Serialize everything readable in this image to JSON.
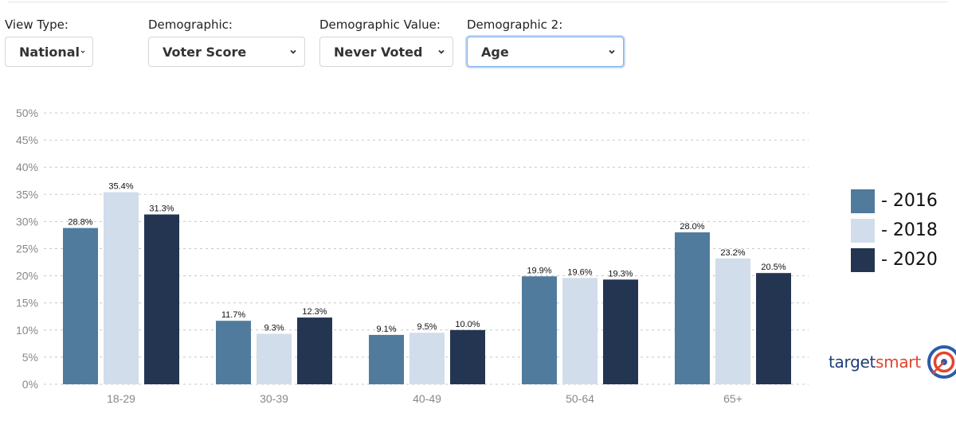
{
  "controls": [
    {
      "label": "View Type:",
      "value": "National"
    },
    {
      "label": "Demographic:",
      "value": "Voter Score"
    },
    {
      "label": "Demographic Value:",
      "value": "Never Voted"
    },
    {
      "label": "Demographic 2:",
      "value": "Age"
    }
  ],
  "legend": [
    {
      "label": "- 2016",
      "color": "#507b9c"
    },
    {
      "label": "- 2018",
      "color": "#d2ddeb"
    },
    {
      "label": "- 2020",
      "color": "#243551"
    }
  ],
  "logo": {
    "part1": "target",
    "part2": "smart"
  },
  "chart_data": {
    "type": "bar",
    "title": "",
    "xlabel": "",
    "ylabel": "",
    "categories": [
      "18-29",
      "30-39",
      "40-49",
      "50-64",
      "65+"
    ],
    "series": [
      {
        "name": "2016",
        "color": "#507b9c",
        "values": [
          28.8,
          11.7,
          9.1,
          19.9,
          28.0
        ],
        "labels": [
          "28.8%",
          "11.7%",
          "9.1%",
          "19.9%",
          "28.0%"
        ]
      },
      {
        "name": "2018",
        "color": "#d2ddeb",
        "values": [
          35.4,
          9.3,
          9.5,
          19.6,
          23.2
        ],
        "labels": [
          "35.4%",
          "9.3%",
          "9.5%",
          "19.6%",
          "23.2%"
        ]
      },
      {
        "name": "2020",
        "color": "#243551",
        "values": [
          31.3,
          12.3,
          10.0,
          19.3,
          20.5
        ],
        "labels": [
          "31.3%",
          "12.3%",
          "10.0%",
          "19.3%",
          "20.5%"
        ]
      }
    ],
    "ylim": [
      0,
      50
    ],
    "yticks": [
      "0%",
      "5%",
      "10%",
      "15%",
      "20%",
      "25%",
      "30%",
      "35%",
      "40%",
      "45%",
      "50%"
    ],
    "grid": true,
    "legend_position": "right"
  }
}
